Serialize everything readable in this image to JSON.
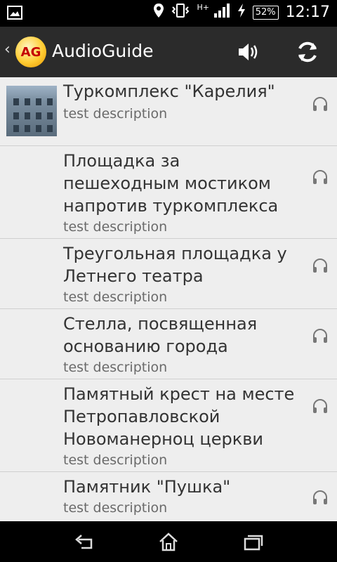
{
  "status_bar": {
    "time": "12:17",
    "battery": "52%",
    "network": "H+",
    "icons": [
      "picture-icon",
      "location-icon",
      "vibrate-icon",
      "signal-icon",
      "charging-icon",
      "battery-icon"
    ]
  },
  "action_bar": {
    "logo_text": "AG",
    "title": "AudioGuide",
    "actions": [
      "volume-icon",
      "refresh-icon"
    ]
  },
  "list": {
    "items": [
      {
        "title": "Туркомплекс \"Карелия\"",
        "description": "test description",
        "has_image": true
      },
      {
        "title": "Площадка за пешеходным мостиком напротив туркомплекса",
        "description": "test description",
        "has_image": false
      },
      {
        "title": "Треугольная площадка у Летнего театра",
        "description": "test description",
        "has_image": false
      },
      {
        "title": "Стелла, посвященная основанию города",
        "description": "test description",
        "has_image": false
      },
      {
        "title": "Памятный крест на месте Петропавловской Новоманерноц церкви",
        "description": "test description",
        "has_image": false
      },
      {
        "title": "Памятник \"Пушка\"",
        "description": "test description",
        "has_image": false
      }
    ]
  },
  "nav_bar": {
    "buttons": [
      "back-icon",
      "home-icon",
      "recent-apps-icon"
    ]
  },
  "colors": {
    "status_bg": "#000000",
    "action_bar_bg": "#2b2b2b",
    "list_bg": "#eeeeee",
    "title_text": "#333333",
    "desc_text": "#6a6a6a"
  }
}
